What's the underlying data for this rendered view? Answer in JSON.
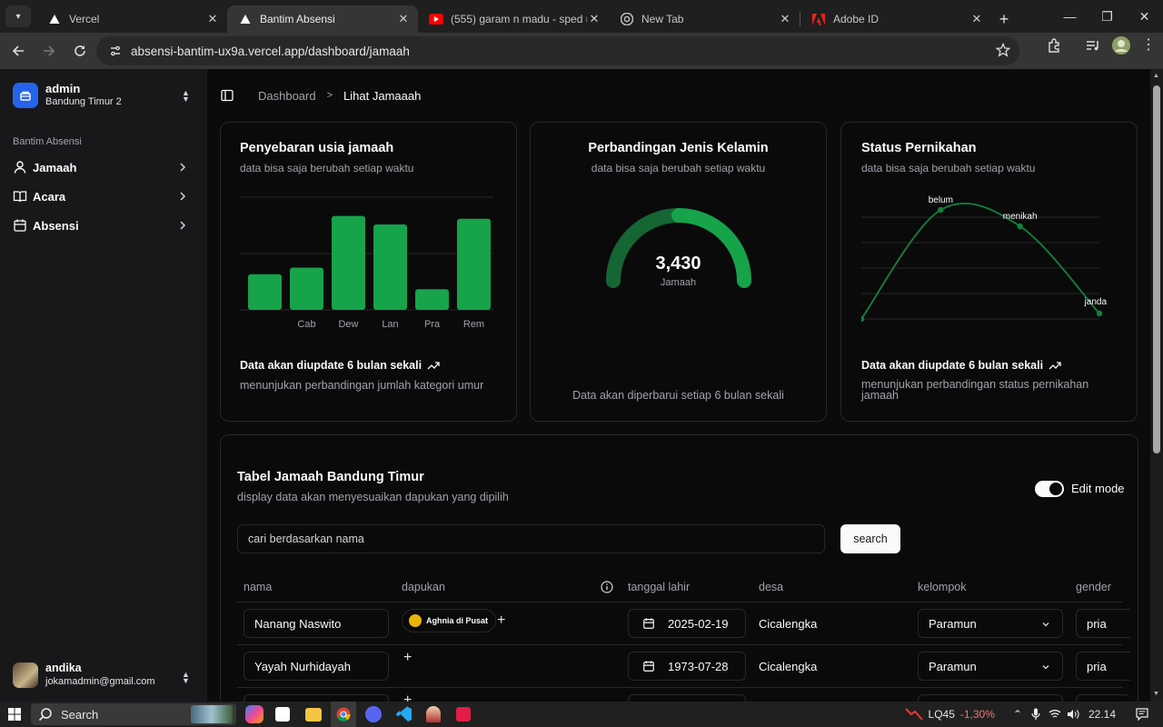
{
  "browser": {
    "tabs": [
      {
        "title": "Vercel",
        "icon": "vercel-triangle-icon"
      },
      {
        "title": "Bantim Absensi",
        "icon": "vercel-triangle-icon"
      },
      {
        "title": "(555) garam n madu - sped up",
        "icon": "youtube-icon"
      },
      {
        "title": "New Tab",
        "icon": "chrome-icon"
      },
      {
        "title": "Adobe ID",
        "icon": "adobe-icon"
      }
    ],
    "url": "absensi-bantim-ux9a.vercel.app/dashboard/jamaah"
  },
  "sidebar": {
    "workspace_name": "admin",
    "workspace_sub": "Bandung Timur 2",
    "group_label": "Bantim Absensi",
    "items": [
      {
        "label": "Jamaah",
        "icon": "user-icon"
      },
      {
        "label": "Acara",
        "icon": "book-open-icon"
      },
      {
        "label": "Absensi",
        "icon": "calendar-icon"
      }
    ],
    "user_name": "andika",
    "user_email": "jokamadmin@gmail.com"
  },
  "breadcrumb": {
    "root": "Dashboard",
    "current": "Lihat Jamaaah"
  },
  "cards": {
    "age": {
      "title": "Penyebaran usia jamaah",
      "subtitle": "data bisa saja berubah setiap waktu",
      "footer_title": "Data akan diupdate 6 bulan sekali",
      "footer_desc": "menunjukan perbandingan jumlah kategori umur"
    },
    "gender": {
      "title": "Perbandingan Jenis Kelamin",
      "subtitle": "data bisa saja berubah setiap waktu",
      "total": "3,430",
      "total_label": "Jamaah",
      "footer": "Data akan diperbarui setiap 6 bulan sekali"
    },
    "marital": {
      "title": "Status Pernikahan",
      "subtitle": "data bisa saja berubah setiap waktu",
      "footer_title": "Data akan diupdate 6 bulan sekali",
      "footer_desc": "menunjukan perbandingan status pernikahan jamaah"
    }
  },
  "chart_data": [
    {
      "type": "bar",
      "categories": [
        "",
        "Cab",
        "Dew",
        "Lan",
        "Pra",
        "Rem"
      ],
      "values": [
        38,
        45,
        100,
        91,
        22,
        97
      ],
      "ylim": [
        0,
        120
      ],
      "grid": true,
      "color": "#16a34a"
    },
    {
      "type": "pie",
      "variant": "half-donut",
      "slices": [
        {
          "value": 0.5,
          "color": "#166534"
        },
        {
          "value": 0.5,
          "color": "#16a34a"
        }
      ]
    },
    {
      "type": "line",
      "categories": [
        "-",
        "belum",
        "menikah",
        "janda"
      ],
      "values": [
        0,
        100,
        85,
        5
      ],
      "ylim": [
        0,
        110
      ],
      "grid": true,
      "color": "#15803d"
    }
  ],
  "table": {
    "title": "Tabel Jamaah Bandung Timur",
    "subtitle": "display data akan menyesuaikan dapukan yang dipilih",
    "edit_mode_label": "Edit mode",
    "edit_mode_on": true,
    "search_placeholder": "cari berdasarkan nama",
    "search_button": "search",
    "columns": [
      "nama",
      "dapukan",
      "tanggal lahir",
      "desa",
      "kelompok",
      "gender"
    ],
    "rows": [
      {
        "nama": "Nanang Naswito",
        "dapukan": "Aghnia di Pusat",
        "tanggal_lahir": "2025-02-19",
        "desa": "Cicalengka",
        "kelompok": "Paramun",
        "gender": "pria"
      },
      {
        "nama": "Yayah Nurhidayah",
        "dapukan": "",
        "tanggal_lahir": "1973-07-28",
        "desa": "Cicalengka",
        "kelompok": "Paramun",
        "gender": "pria"
      }
    ]
  },
  "taskbar": {
    "search_label": "Search",
    "stock_name": "LQ45",
    "stock_change": "-1,30%",
    "time": "22.14"
  }
}
